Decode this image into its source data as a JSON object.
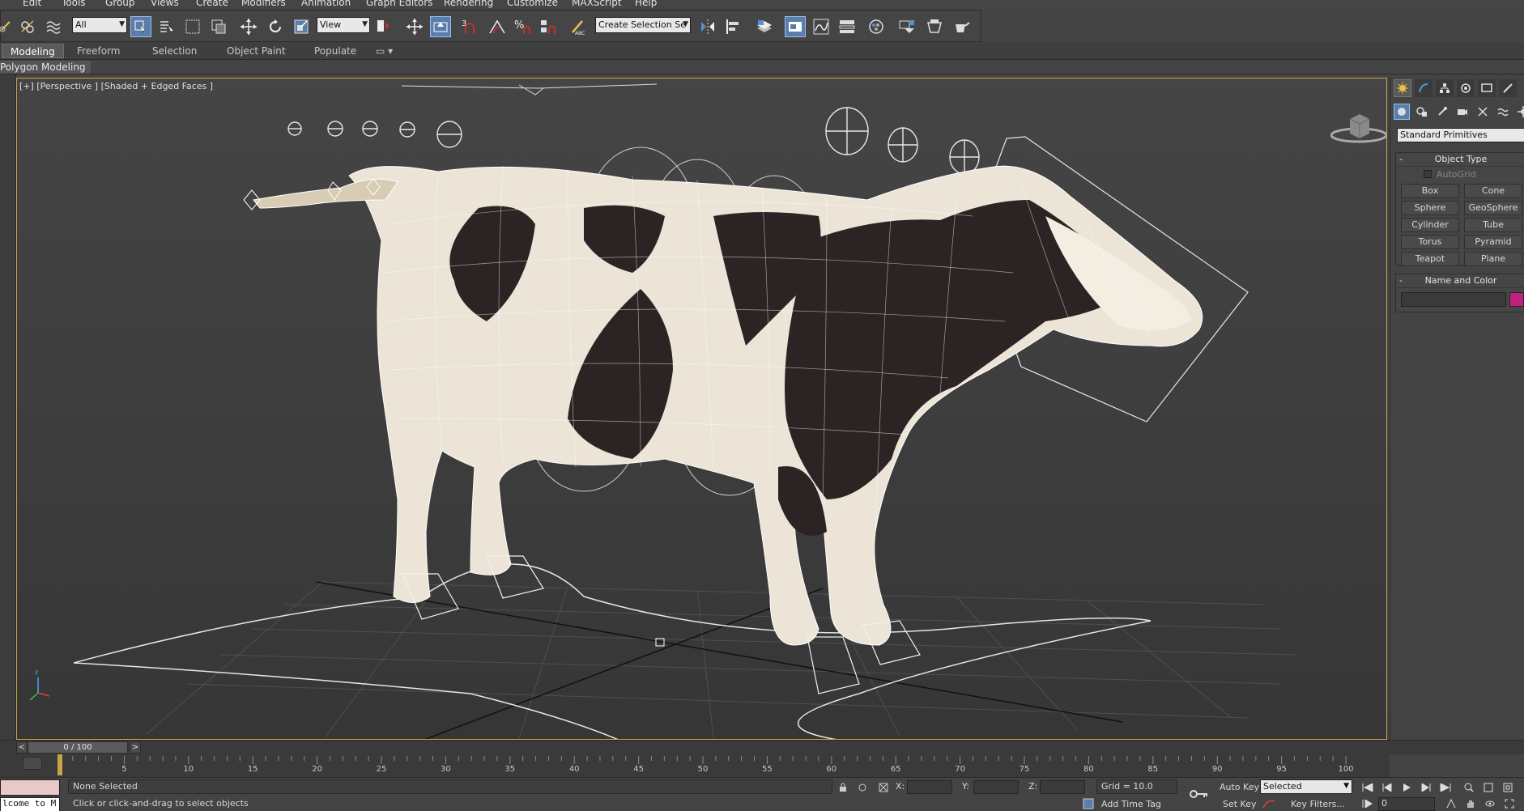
{
  "menu": [
    "Edit",
    "Tools",
    "Group",
    "Views",
    "Create",
    "Modifiers",
    "Animation",
    "Graph Editors",
    "Rendering",
    "Customize",
    "MAXScript",
    "Help"
  ],
  "toolbar": {
    "filter_value": "All",
    "ref_coord_value": "View",
    "named_selection_value": "Create Selection Se"
  },
  "ribbon": {
    "tabs": [
      "Modeling",
      "Freeform",
      "Selection",
      "Object Paint",
      "Populate"
    ],
    "active_tab": "Modeling",
    "sub_label": "Polygon Modeling"
  },
  "viewport": {
    "label": "[+] [Perspective ] [Shaded + Edged Faces ]",
    "border_color": "#c8a548"
  },
  "command_panel": {
    "tabs": [
      "create-icon",
      "modify-icon",
      "hierarchy-icon",
      "motion-icon",
      "display-icon",
      "utilities-icon"
    ],
    "category_value": "Standard Primitives",
    "object_type": {
      "title": "Object Type",
      "autogrid_label": "AutoGrid",
      "buttons": [
        "Box",
        "Cone",
        "Sphere",
        "GeoSphere",
        "Cylinder",
        "Tube",
        "Torus",
        "Pyramid",
        "Teapot",
        "Plane"
      ]
    },
    "name_color": {
      "title": "Name and Color",
      "name_value": "",
      "swatch_color": "#c02080"
    }
  },
  "time_slider": {
    "frame_label": "0 / 100",
    "prev_label": "<",
    "next_label": ">",
    "ticks": [
      "5",
      "10",
      "15",
      "20",
      "25",
      "30",
      "35",
      "40",
      "45",
      "50",
      "55",
      "60",
      "65",
      "70",
      "75",
      "80",
      "85",
      "90",
      "95",
      "100"
    ]
  },
  "status": {
    "maxscript_text": "lcome to M",
    "selection_text": "None Selected",
    "prompt_text": "Click or click-and-drag to select objects",
    "x_label": "X:",
    "y_label": "Y:",
    "z_label": "Z:",
    "grid_text": "Grid = 10.0",
    "add_time_tag": "Add Time Tag",
    "auto_key": "Auto Key",
    "auto_key_value": "Selected",
    "set_key": "Set Key",
    "key_filters": "Key Filters...",
    "frame_value": "0"
  }
}
